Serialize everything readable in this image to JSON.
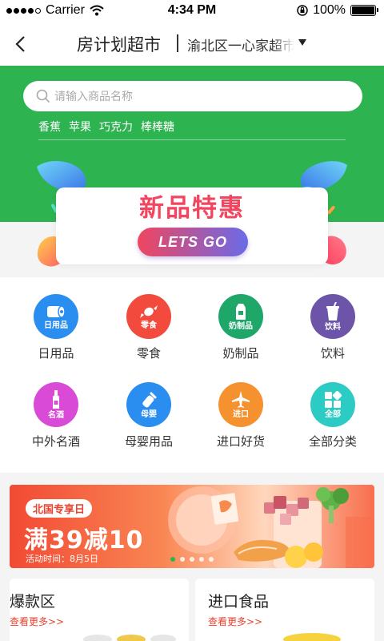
{
  "status_bar": {
    "carrier": "Carrier",
    "time": "4:34 PM",
    "battery": "100%",
    "battery_level": 1.0
  },
  "nav": {
    "title": "房计划超市",
    "location": "渝北区一心家超市",
    "back_icon": "chevron-left-icon",
    "dropdown_icon": "caret-down-icon"
  },
  "search": {
    "placeholder": "请输入商品名称",
    "icon": "search-icon"
  },
  "hot_tags": [
    "香蕉",
    "苹果",
    "巧克力",
    "棒棒糖"
  ],
  "banner": {
    "title": "新品特惠",
    "cta": "LETS GO"
  },
  "categories": [
    {
      "label": "日用品",
      "badge": "日用品",
      "icon": "tissue-roll-icon",
      "color": "#2a8ef0"
    },
    {
      "label": "零食",
      "badge": "零食",
      "icon": "candy-icon",
      "color": "#f24a3c"
    },
    {
      "label": "奶制品",
      "badge": "奶制品",
      "icon": "milk-box-icon",
      "color": "#1fa76a"
    },
    {
      "label": "饮料",
      "badge": "饮料",
      "icon": "drink-cup-icon",
      "color": "#6c55a8"
    },
    {
      "label": "中外名酒",
      "badge": "名酒",
      "icon": "wine-bottle-icon",
      "color": "#d94bd6"
    },
    {
      "label": "母婴用品",
      "badge": "母婴",
      "icon": "baby-bottle-icon",
      "color": "#2a8ef0"
    },
    {
      "label": "进口好货",
      "badge": "进口",
      "icon": "airplane-icon",
      "color": "#f5912f"
    },
    {
      "label": "全部分类",
      "badge": "全部",
      "icon": "grid-icon",
      "color": "#2ccbc3"
    }
  ],
  "promo": {
    "tag": "北国专享日",
    "headline": "满39减10",
    "date": "活动时间：8月5日",
    "slides": 5,
    "active_slide": 0
  },
  "sections": [
    {
      "title": "爆款区",
      "more": "查看更多>>"
    },
    {
      "title": "进口食品",
      "more": "查看更多>>"
    }
  ],
  "colors": {
    "brand_green": "#2eb351",
    "accent_red": "#e8412e",
    "banner_pink": "#f2455f"
  }
}
